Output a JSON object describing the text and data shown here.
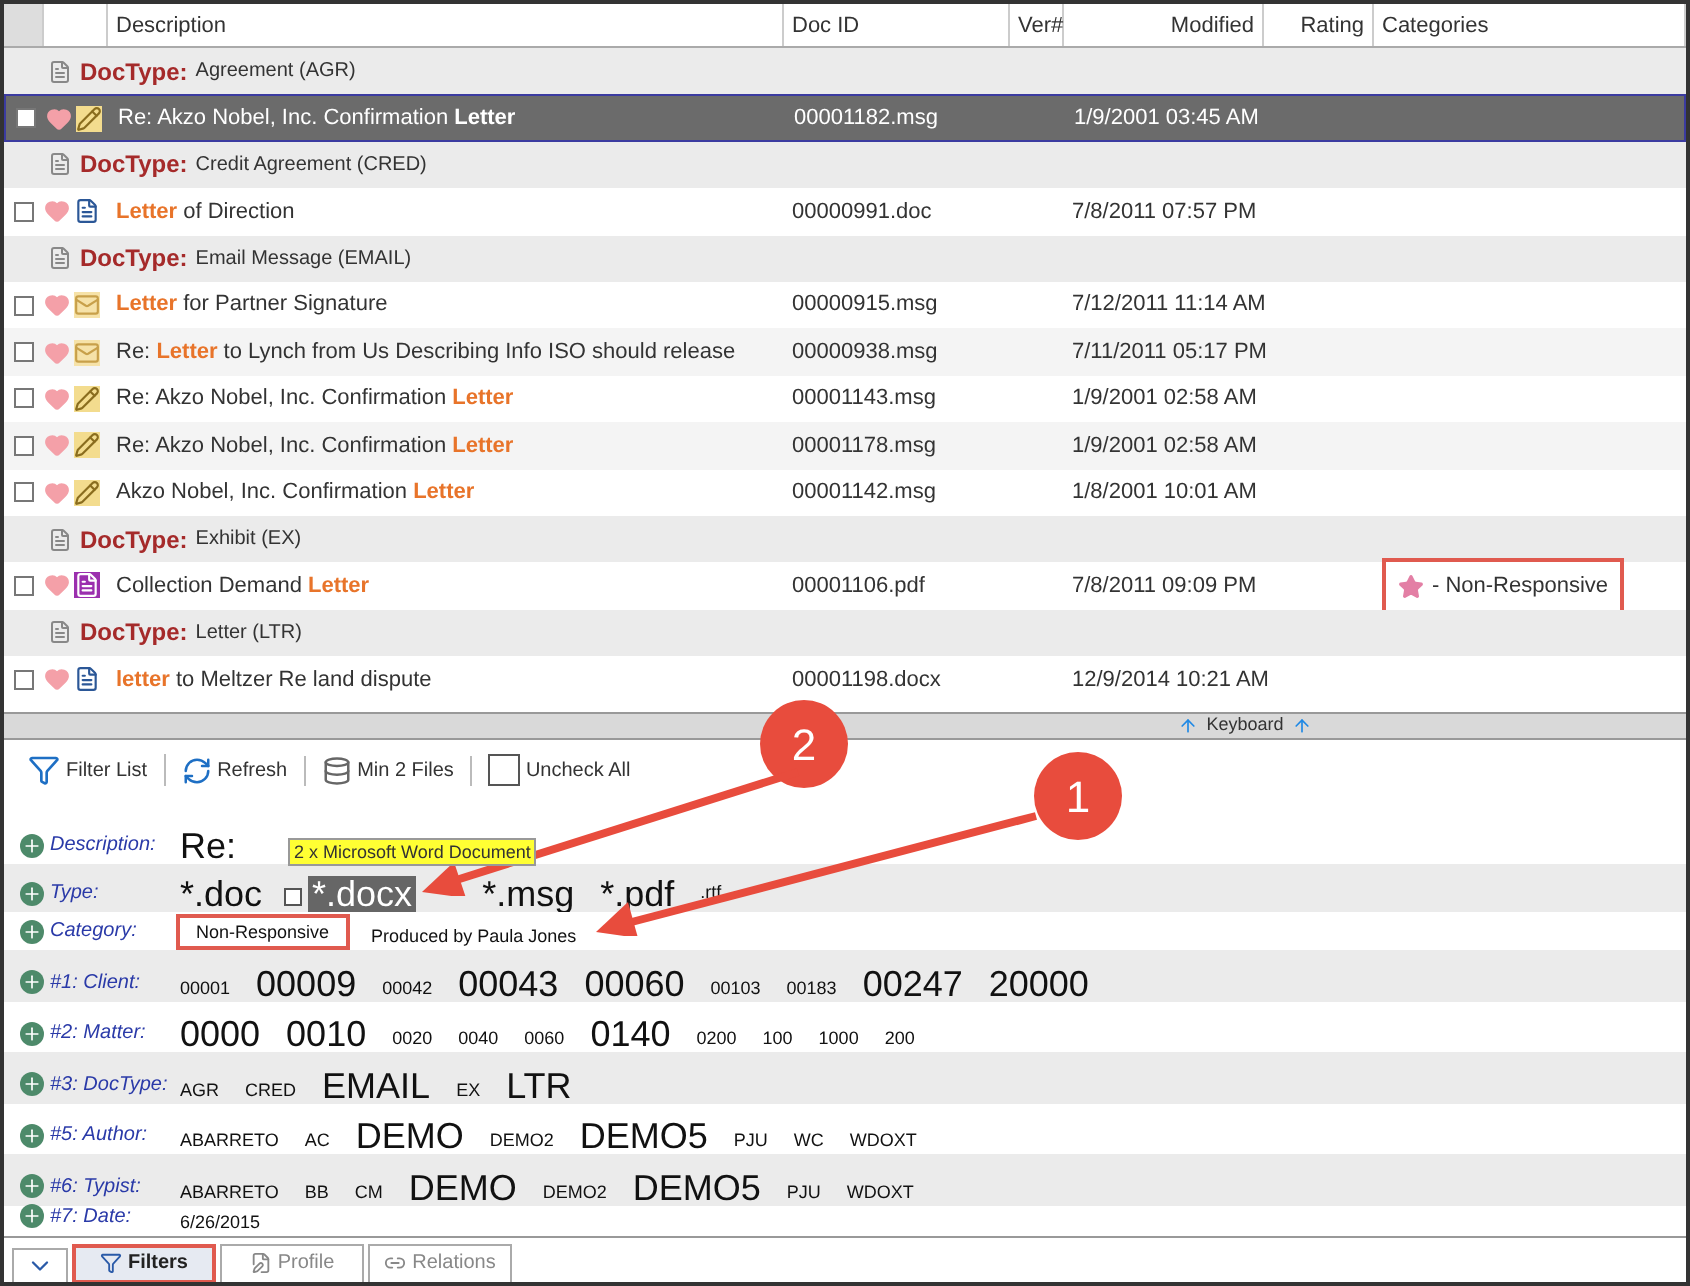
{
  "columns": [
    "Description",
    "Doc ID",
    "Ver#",
    "Modified",
    "Rating",
    "Categories"
  ],
  "rows": [
    {
      "kind": "group",
      "label": "DocType:",
      "value": "Agreement  (AGR)"
    },
    {
      "kind": "doc",
      "selected": true,
      "file": {
        "kind": "edit"
      },
      "description": "Re: Akzo Nobel, Inc. Confirmation **Letter**",
      "doc_id": "00001182.msg",
      "modified": "1/9/2001 03:45 AM"
    },
    {
      "kind": "group",
      "label": "DocType:",
      "value": "Credit Agreement  (CRED)"
    },
    {
      "kind": "doc",
      "selected": false,
      "file": {
        "kind": "word"
      },
      "description": "**Letter** of Direction",
      "doc_id": "00000991.doc",
      "modified": "7/8/2011 07:57 PM"
    },
    {
      "kind": "group",
      "label": "DocType:",
      "value": "Email Message  (EMAIL)"
    },
    {
      "kind": "doc",
      "selected": false,
      "file": {
        "kind": "email"
      },
      "description": "**Letter** for Partner Signature",
      "doc_id": "00000915.msg",
      "modified": "7/12/2011 11:14 AM"
    },
    {
      "kind": "doc",
      "selected": false,
      "file": {
        "kind": "email"
      },
      "description": "Re: **Letter** to Lynch from Us Describing Info ISO should release",
      "doc_id": "00000938.msg",
      "modified": "7/11/2011 05:17 PM"
    },
    {
      "kind": "doc",
      "selected": false,
      "file": {
        "kind": "edit"
      },
      "description": "Re: Akzo Nobel, Inc. Confirmation **Letter**",
      "doc_id": "00001143.msg",
      "modified": "1/9/2001 02:58 AM"
    },
    {
      "kind": "doc",
      "selected": false,
      "file": {
        "kind": "edit"
      },
      "description": "Re: Akzo Nobel, Inc. Confirmation **Letter**",
      "doc_id": "00001178.msg",
      "modified": "1/9/2001 02:58 AM"
    },
    {
      "kind": "doc",
      "selected": false,
      "file": {
        "kind": "edit"
      },
      "description": "Akzo Nobel, Inc. Confirmation **Letter**",
      "doc_id": "00001142.msg",
      "modified": "1/8/2001 10:01 AM"
    },
    {
      "kind": "group",
      "label": "DocType:",
      "value": "Exhibit  (EX)"
    },
    {
      "kind": "doc",
      "selected": false,
      "file": {
        "kind": "pdf"
      },
      "description": "Collection Demand **Letter**",
      "doc_id": "00001106.pdf",
      "modified": "7/8/2011 09:09 PM",
      "category": "- Non-Responsive",
      "category_highlighted": true
    },
    {
      "kind": "group",
      "label": "DocType:",
      "value": "Letter  (LTR)"
    },
    {
      "kind": "doc",
      "selected": false,
      "file": {
        "kind": "word"
      },
      "description": "**letter** to Meltzer Re land dispute",
      "doc_id": "00001198.docx",
      "modified": "12/9/2014 10:21 AM"
    }
  ],
  "keyboard_label": "Keyboard",
  "toolbar": [
    "Filter List",
    "Refresh",
    "Min 2 Files",
    "Uncheck All"
  ],
  "filters": [
    {
      "label": "Description:",
      "tags": [
        {
          "text": "Re:",
          "large": true,
          "selected": false,
          "highlighted": false
        }
      ]
    },
    {
      "label": "Type:",
      "tooltip": "2 x Microsoft Word Document",
      "tags": [
        {
          "text": "*.doc",
          "large": true,
          "selected": false,
          "highlighted": false
        },
        {
          "text": "*.docx",
          "large": true,
          "selected": true,
          "highlighted": false
        },
        {
          "text": "*.msg",
          "large": true,
          "selected": false,
          "highlighted": false
        },
        {
          "text": "*.pdf",
          "large": true,
          "selected": false,
          "highlighted": false
        },
        {
          "text": ".rtf",
          "large": false,
          "selected": false,
          "highlighted": false
        }
      ]
    },
    {
      "label": "Category:",
      "tags": [
        {
          "text": "Non-Responsive",
          "large": false,
          "selected": false,
          "highlighted": true
        },
        {
          "text": "Produced by Paula Jones",
          "large": false,
          "selected": false,
          "highlighted": false
        }
      ]
    },
    {
      "label": "#1: Client:",
      "tags": [
        {
          "text": "00001",
          "large": false,
          "selected": false,
          "highlighted": false
        },
        {
          "text": "00009",
          "large": true,
          "selected": false,
          "highlighted": false
        },
        {
          "text": "00042",
          "large": false,
          "selected": false,
          "highlighted": false
        },
        {
          "text": "00043",
          "large": true,
          "selected": false,
          "highlighted": false
        },
        {
          "text": "00060",
          "large": true,
          "selected": false,
          "highlighted": false
        },
        {
          "text": "00103",
          "large": false,
          "selected": false,
          "highlighted": false
        },
        {
          "text": "00183",
          "large": false,
          "selected": false,
          "highlighted": false
        },
        {
          "text": "00247",
          "large": true,
          "selected": false,
          "highlighted": false
        },
        {
          "text": "20000",
          "large": true,
          "selected": false,
          "highlighted": false
        }
      ]
    },
    {
      "label": "#2: Matter:",
      "tags": [
        {
          "text": "0000",
          "large": true,
          "selected": false,
          "highlighted": false
        },
        {
          "text": "0010",
          "large": true,
          "selected": false,
          "highlighted": false
        },
        {
          "text": "0020",
          "large": false,
          "selected": false,
          "highlighted": false
        },
        {
          "text": "0040",
          "large": false,
          "selected": false,
          "highlighted": false
        },
        {
          "text": "0060",
          "large": false,
          "selected": false,
          "highlighted": false
        },
        {
          "text": "0140",
          "large": true,
          "selected": false,
          "highlighted": false
        },
        {
          "text": "0200",
          "large": false,
          "selected": false,
          "highlighted": false
        },
        {
          "text": "100",
          "large": false,
          "selected": false,
          "highlighted": false
        },
        {
          "text": "1000",
          "large": false,
          "selected": false,
          "highlighted": false
        },
        {
          "text": "200",
          "large": false,
          "selected": false,
          "highlighted": false
        }
      ]
    },
    {
      "label": "#3: DocType:",
      "tags": [
        {
          "text": "AGR",
          "large": false,
          "selected": false,
          "highlighted": false
        },
        {
          "text": "CRED",
          "large": false,
          "selected": false,
          "highlighted": false
        },
        {
          "text": "EMAIL",
          "large": true,
          "selected": false,
          "highlighted": false
        },
        {
          "text": "EX",
          "large": false,
          "selected": false,
          "highlighted": false
        },
        {
          "text": "LTR",
          "large": true,
          "selected": false,
          "highlighted": false
        }
      ]
    },
    {
      "label": "#5: Author:",
      "tags": [
        {
          "text": "ABARRETO",
          "large": false,
          "selected": false,
          "highlighted": false
        },
        {
          "text": "AC",
          "large": false,
          "selected": false,
          "highlighted": false
        },
        {
          "text": "DEMO",
          "large": true,
          "selected": false,
          "highlighted": false
        },
        {
          "text": "DEMO2",
          "large": false,
          "selected": false,
          "highlighted": false
        },
        {
          "text": "DEMO5",
          "large": true,
          "selected": false,
          "highlighted": false
        },
        {
          "text": "PJU",
          "large": false,
          "selected": false,
          "highlighted": false
        },
        {
          "text": "WC",
          "large": false,
          "selected": false,
          "highlighted": false
        },
        {
          "text": "WDOXT",
          "large": false,
          "selected": false,
          "highlighted": false
        }
      ]
    },
    {
      "label": "#6: Typist:",
      "tags": [
        {
          "text": "ABARRETO",
          "large": false,
          "selected": false,
          "highlighted": false
        },
        {
          "text": "BB",
          "large": false,
          "selected": false,
          "highlighted": false
        },
        {
          "text": "CM",
          "large": false,
          "selected": false,
          "highlighted": false
        },
        {
          "text": "DEMO",
          "large": true,
          "selected": false,
          "highlighted": false
        },
        {
          "text": "DEMO2",
          "large": false,
          "selected": false,
          "highlighted": false
        },
        {
          "text": "DEMO5",
          "large": true,
          "selected": false,
          "highlighted": false
        },
        {
          "text": "PJU",
          "large": false,
          "selected": false,
          "highlighted": false
        },
        {
          "text": "WDOXT",
          "large": false,
          "selected": false,
          "highlighted": false
        }
      ]
    },
    {
      "label": "#7: Date:",
      "tags": [
        {
          "text": "6/26/2015",
          "large": false,
          "selected": false,
          "highlighted": false
        }
      ]
    }
  ],
  "tabs": [
    {
      "label": "Filters",
      "selected": true,
      "highlighted": true
    },
    {
      "label": "Profile",
      "selected": false,
      "highlighted": false
    },
    {
      "label": "Relations",
      "selected": false,
      "highlighted": false
    }
  ],
  "callouts": [
    "2",
    "1"
  ]
}
